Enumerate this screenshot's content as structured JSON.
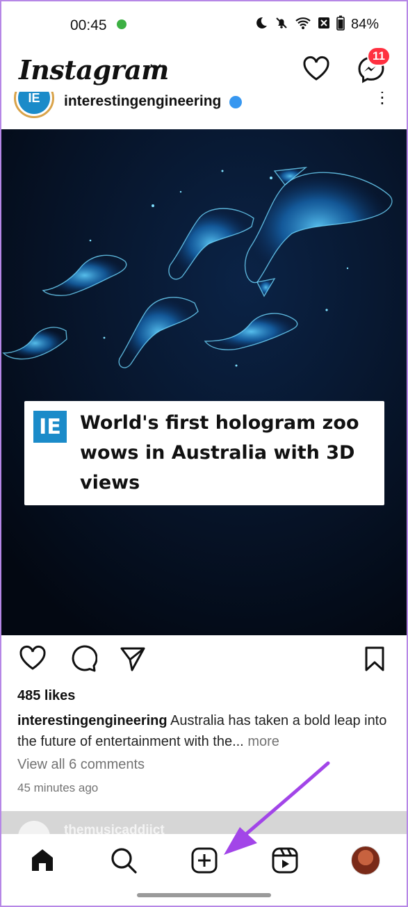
{
  "status_bar": {
    "time": "00:45",
    "battery": "84%",
    "indicator_color": "#3cb043"
  },
  "top_bar": {
    "logo": "Instagram",
    "messenger_badge": "11"
  },
  "post": {
    "username": "interestingengineering",
    "avatar_text": "IE",
    "media": {
      "logo_text": "IE",
      "headline": "World's first hologram zoo wows in Australia with 3D views"
    },
    "likes": "485 likes",
    "caption_username": "interestingengineering",
    "caption_text": "Australia has taken a bold leap into the future of entertainment with the...",
    "caption_more": "more",
    "view_comments": "View all 6 comments",
    "time_ago": "45 minutes ago"
  },
  "next_post": {
    "username": "themusicaddiict"
  },
  "bottom_nav": {
    "items": [
      "home-icon",
      "search-icon",
      "create-icon",
      "reels-icon",
      "profile-avatar"
    ]
  },
  "colors": {
    "accent_badge": "#ff3040",
    "annotation_arrow": "#a245e8",
    "verified": "#3797f0"
  }
}
